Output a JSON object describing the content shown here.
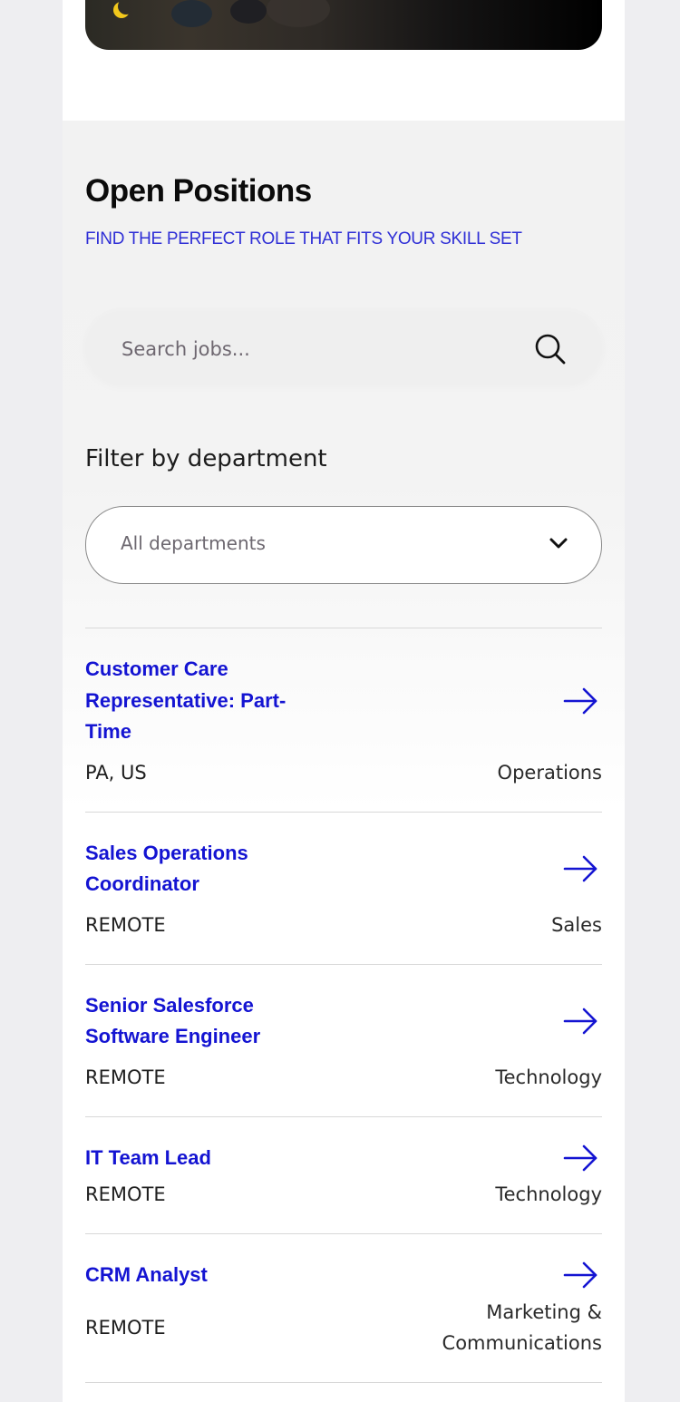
{
  "section": {
    "title": "Open Positions",
    "subtitle": "FIND THE PERFECT ROLE THAT FITS YOUR SKILL SET"
  },
  "search": {
    "placeholder": "Search jobs...",
    "value": "",
    "icon": "search-icon"
  },
  "filter": {
    "label": "Filter by department",
    "selected": "All departments",
    "icon": "chevron-down-icon"
  },
  "jobs": [
    {
      "title": "Customer Care Representative: Part-Time",
      "location": "PA, US",
      "department": "Operations"
    },
    {
      "title": "Sales Operations Coordinator",
      "location": "REMOTE",
      "department": "Sales"
    },
    {
      "title": "Senior Salesforce Software Engineer",
      "location": "REMOTE",
      "department": "Technology"
    },
    {
      "title": "IT Team Lead",
      "location": "REMOTE",
      "department": "Technology"
    },
    {
      "title": "CRM Analyst",
      "location": "REMOTE",
      "department": "Marketing & Communications"
    }
  ],
  "colors": {
    "accent": "#1414d2",
    "subtitle": "#2f2fd6",
    "page_background": "#eeeef1"
  }
}
